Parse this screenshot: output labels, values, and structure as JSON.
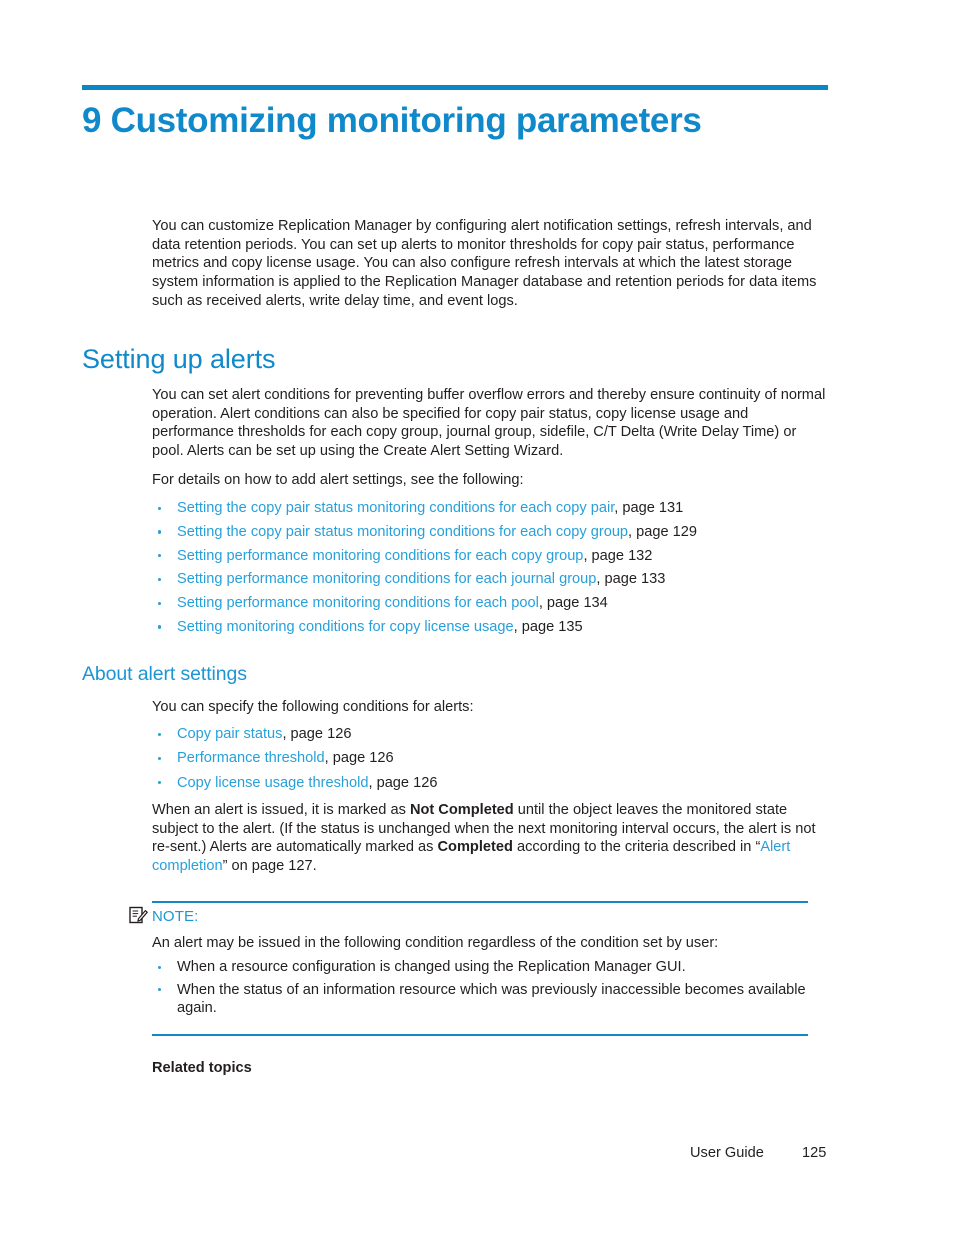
{
  "chapter": {
    "number_title": "9 Customizing monitoring parameters"
  },
  "intro": {
    "paragraph": "You can customize Replication Manager by configuring alert notification settings, refresh intervals, and data retention periods. You can set up alerts to monitor thresholds for copy pair status, performance metrics and copy license usage. You can also configure refresh intervals at which the latest storage system information is applied to the Replication Manager database and retention periods for data items such as received alerts, write delay time, and event logs."
  },
  "setting_up_alerts": {
    "heading": "Setting up alerts",
    "paragraph": "You can set alert conditions for preventing buffer overflow errors and thereby ensure continuity of normal operation. Alert conditions can also be specified for copy pair status, copy license usage and performance thresholds for each copy group, journal group, sidefile, C/T Delta (Write Delay Time) or pool. Alerts can be set up using the Create Alert Setting Wizard.",
    "lead_in": "For details on how to add alert settings, see the following:",
    "links": [
      {
        "text": "Setting the copy pair status monitoring conditions for each copy pair",
        "page_ref": ", page 131"
      },
      {
        "text": "Setting the copy pair status monitoring conditions for each copy group",
        "page_ref": ", page 129"
      },
      {
        "text": "Setting performance monitoring conditions for each copy group",
        "page_ref": ", page 132"
      },
      {
        "text": "Setting performance monitoring conditions for each journal group",
        "page_ref": ", page 133"
      },
      {
        "text": "Setting performance monitoring conditions for each pool",
        "page_ref": ", page 134"
      },
      {
        "text": "Setting monitoring conditions for copy license usage",
        "page_ref": ", page 135"
      }
    ]
  },
  "about_alert_settings": {
    "heading": "About alert settings",
    "lead_in": "You can specify the following conditions for alerts:",
    "links": [
      {
        "text": "Copy pair status",
        "page_ref": ", page 126"
      },
      {
        "text": "Performance threshold",
        "page_ref": ", page 126"
      },
      {
        "text": "Copy license usage threshold",
        "page_ref": ", page 126"
      }
    ],
    "paragraph_parts": {
      "p1": "When an alert is issued, it is marked as ",
      "bold1": "Not Completed",
      "p2": " until the object leaves the monitored state subject to the alert. (If the status is unchanged when the next monitoring interval occurs, the alert is not re-sent.) Alerts are automatically marked as ",
      "bold2": "Completed",
      "p3": " according to the criteria described in “",
      "link1": "Alert completion",
      "p4": "” on page 127."
    }
  },
  "note": {
    "icon_name": "note-icon",
    "label": "NOTE:",
    "lead_in": "An alert may be issued in the following condition regardless of the condition set by user:",
    "bullets": [
      "When a resource configuration is changed using the Replication Manager GUI.",
      "When the status of an information resource which was previously inaccessible becomes available again."
    ]
  },
  "related_topics": {
    "heading": "Related topics"
  },
  "footer": {
    "guide_label": "User Guide",
    "page_number": "125"
  },
  "colors": {
    "chapter_blue": "#1089cb",
    "rule_blue": "#0b87c5",
    "link_blue": "#27a0da",
    "heading_blue": "#1b96d4",
    "body_black": "#231f20"
  }
}
